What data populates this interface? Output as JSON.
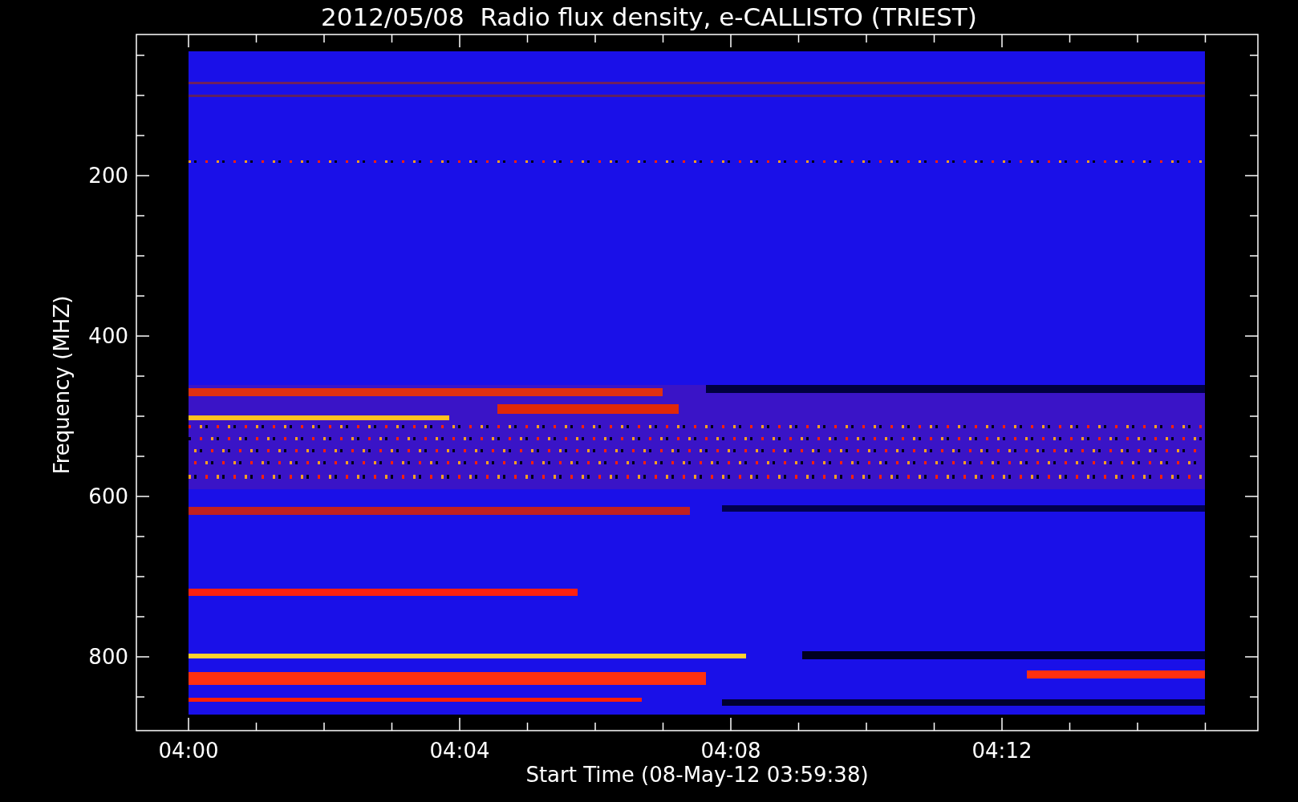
{
  "title": "2012/05/08  Radio flux density, e-CALLISTO (TRIEST)",
  "plot": {
    "ylabel": "Frequency (MHZ)",
    "xlabel": "Start Time (08-May-12 03:59:38)",
    "yticks": [
      "200",
      "400",
      "600",
      "800"
    ],
    "xticks": [
      "04:00",
      "04:04",
      "04:08",
      "04:12"
    ]
  }
}
